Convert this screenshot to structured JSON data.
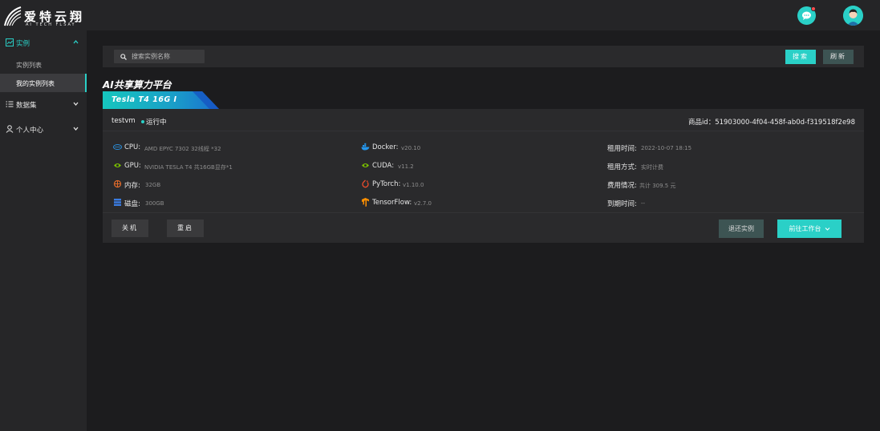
{
  "brand": {
    "name_cn": "爱特云翔",
    "name_en": "AI TECH FLSAY"
  },
  "header": {
    "chat_icon": "chat-bubble-icon",
    "avatar_icon": "user-avatar"
  },
  "sidebar": {
    "groups": [
      {
        "label": "实例",
        "icon": "chart-icon",
        "expanded": true,
        "items": [
          {
            "label": "实例列表"
          },
          {
            "label": "我的实例列表",
            "selected": true
          }
        ]
      },
      {
        "label": "数据集",
        "icon": "list-icon",
        "expanded": false
      },
      {
        "label": "个人中心",
        "icon": "user-icon",
        "expanded": false
      }
    ]
  },
  "search": {
    "placeholder": "搜索实例名称",
    "search_button": "搜索",
    "refresh_button": "刷新"
  },
  "platform_title": "AI共享算力平台",
  "gpu_tab": "Tesla T4 16G I",
  "instance": {
    "name": "testvm",
    "status": "运行中",
    "product_id": "商品id：51903000-4f04-458f-ab0d-f319518f2e98",
    "specs_left": [
      {
        "label": "CPU:",
        "value": "AMD EPYC 7302 32线程 *32",
        "icon": "cpu-icon"
      },
      {
        "label": "GPU:",
        "value": "NVIDIA TESLA T4 共16GB显存*1",
        "icon": "nvidia-icon"
      },
      {
        "label": "内存:",
        "value": "32GB",
        "icon": "memory-icon"
      },
      {
        "label": "磁盘:",
        "value": "300GB",
        "icon": "disk-icon"
      }
    ],
    "specs_mid": [
      {
        "label": "Docker:",
        "value": "v20.10",
        "icon": "docker-icon"
      },
      {
        "label": "CUDA:",
        "value": "v11.2",
        "icon": "nvidia-icon"
      },
      {
        "label": "PyTorch:",
        "value": "v1.10.0",
        "icon": "pytorch-icon"
      },
      {
        "label": "TensorFlow:",
        "value": "v2.7.0",
        "icon": "tensorflow-icon"
      }
    ],
    "specs_right": [
      {
        "label": "租用时间:",
        "value": "2022-10-07 18:15"
      },
      {
        "label": "租用方式:",
        "value": "实时计费"
      },
      {
        "label": "费用情况:",
        "value": "共计 309.5 元"
      },
      {
        "label": "到期时间:",
        "value": "--"
      }
    ],
    "buttons": {
      "shutdown": "关机",
      "restart": "重启",
      "return": "退还实例",
      "workbench": "前往工作台"
    }
  },
  "colors": {
    "accent": "#2ad0c7",
    "background": "#1c1c1e",
    "panel": "#2a2a2c",
    "sidebar": "#262628"
  }
}
